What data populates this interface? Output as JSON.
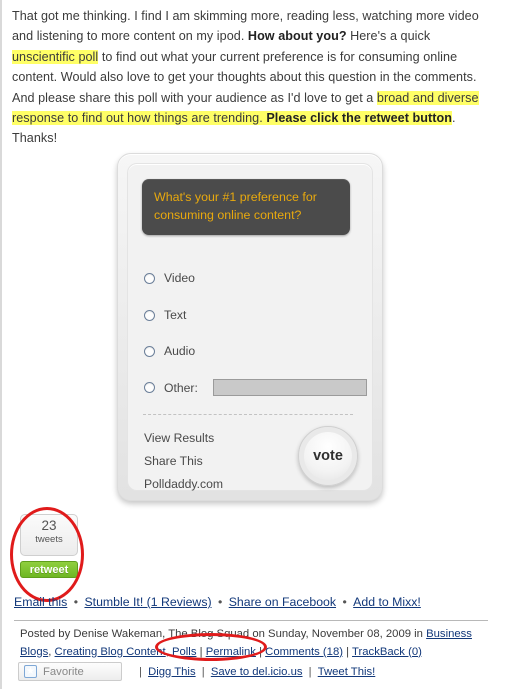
{
  "article": {
    "segments": [
      {
        "text": "That got me thinking. I find I am skimming more, reading less, watching more video and listening to more content on my ipod. ",
        "style": "normal"
      },
      {
        "text": "How about you?",
        "style": "bold"
      },
      {
        "text": " Here's a quick ",
        "style": "normal"
      },
      {
        "text": "unscientific poll",
        "style": "highlight"
      },
      {
        "text": " to find out what your current preference is for consuming online content. Would also love to get your thoughts about this question in the comments. And please share this poll with your audience as I'd love to get a ",
        "style": "normal"
      },
      {
        "text": "broad and diverse response to find out how things are trending. ",
        "style": "highlight"
      },
      {
        "text": "Please click the retweet button",
        "style": "highlight-bold"
      },
      {
        "text": ". Thanks!",
        "style": "normal"
      }
    ]
  },
  "poll": {
    "question": "What's your #1 preference for consuming online content?",
    "question_color": "#e8a90e",
    "question_bg": "#4b4b4b",
    "options": [
      {
        "label": "Video"
      },
      {
        "label": "Text"
      },
      {
        "label": "Audio"
      },
      {
        "label": "Other:"
      }
    ],
    "other_input_value": "",
    "other_input_placeholder": "",
    "links": [
      {
        "label": "View Results"
      },
      {
        "label": "Share This"
      },
      {
        "label": "Polldaddy.com"
      }
    ],
    "vote_label": "vote"
  },
  "retweet": {
    "count": "23",
    "count_label": "tweets",
    "button_label": "retweet",
    "button_color": "#6fb723"
  },
  "share_links": {
    "items": [
      "Email this",
      "Stumble It! (1 Reviews)",
      "Share on Facebook",
      "Add to Mixx!"
    ],
    "separator": "•"
  },
  "post_meta": {
    "prefix": "Posted by Denise Wakeman, The Blog Squad on Sunday, November 08, 2009 in ",
    "categories": [
      "Business Blogs",
      "Creating Blog Content",
      "Polls"
    ],
    "permalink": "Permalink",
    "comments": "Comments (18)",
    "trackback": "TrackBack (0)",
    "separator": "|"
  },
  "bottom_toolbar": {
    "favorite_label": "Favorite",
    "favorite_icon": "star-icon",
    "links": [
      "Digg This",
      "Save to del.icio.us",
      "Tweet This!"
    ],
    "separator": "|"
  },
  "annotations": {
    "color": "#e01b1b",
    "shapes": [
      {
        "name": "retweet-circle",
        "target": "retweet-widget"
      },
      {
        "name": "comments-circle",
        "target": "comments-link"
      }
    ]
  }
}
